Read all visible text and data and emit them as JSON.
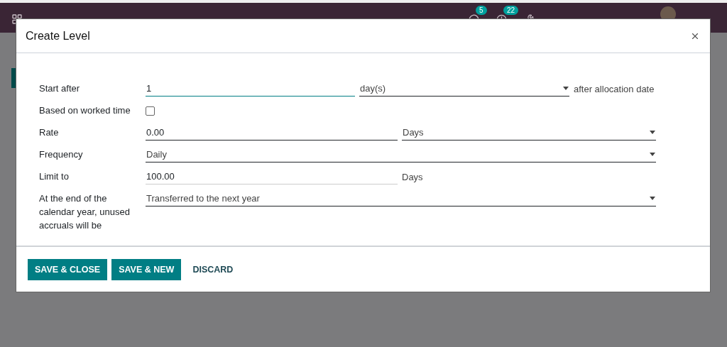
{
  "navbar": {
    "badges": [
      {
        "kind": "chat",
        "count": "5"
      },
      {
        "kind": "activity",
        "count": "22"
      }
    ]
  },
  "dialog": {
    "title": "Create Level",
    "fields": [
      {
        "kind": "input_select",
        "label": "Start after",
        "value": "1",
        "focused": true,
        "unit": "day(s)",
        "suffix": "after allocation date"
      },
      {
        "kind": "checkbox",
        "label": "Based on worked time",
        "checked": false
      },
      {
        "kind": "input_select",
        "label": "Rate",
        "value": "0.00",
        "focused": false,
        "unit": "Days"
      },
      {
        "kind": "select",
        "label": "Frequency",
        "value": "Daily"
      },
      {
        "kind": "input_text",
        "label": "Limit to",
        "value": "100.00",
        "focused": false,
        "suffix": "Days"
      },
      {
        "kind": "select",
        "label": "At the end of the calendar year, unused accruals will be",
        "value": "Transferred to the next year"
      }
    ],
    "buttons": [
      {
        "kind": "primary",
        "label": "SAVE & CLOSE"
      },
      {
        "kind": "primary",
        "label": "SAVE & NEW"
      },
      {
        "kind": "link",
        "label": "DISCARD"
      }
    ]
  }
}
